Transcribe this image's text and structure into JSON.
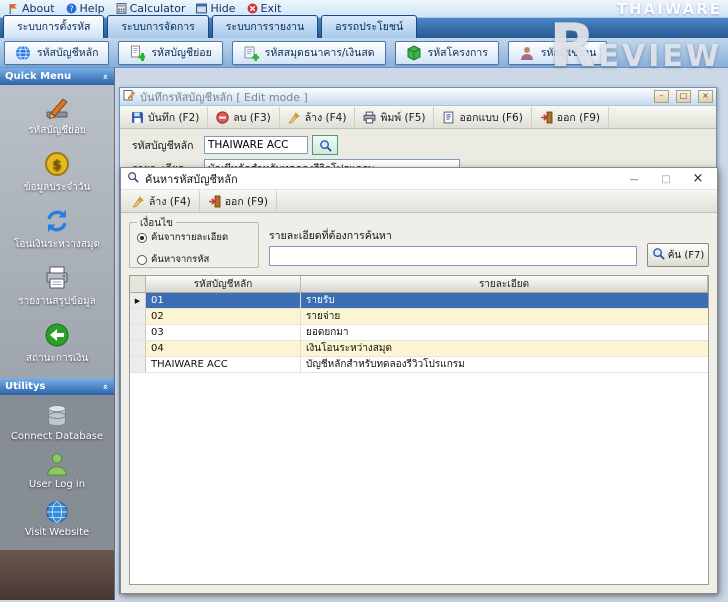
{
  "watermark": {
    "line1": "THAIWARE",
    "line2": "REVIEW"
  },
  "menubar": {
    "items": [
      {
        "label": "About"
      },
      {
        "label": "Help"
      },
      {
        "label": "Calculator"
      },
      {
        "label": "Hide"
      },
      {
        "label": "Exit"
      }
    ]
  },
  "tabs": [
    "ระบบการตั้งรหัส",
    "ระบบการจัดการ",
    "ระบบการรายงาน",
    "อรรถประโยชน์"
  ],
  "toolbar": {
    "buttons": [
      "รหัสบัญชีหลัก",
      "รหัสบัญชีย่อย",
      "รหัสสมุดธนาคาร/เงินสด",
      "รหัสโครงการ",
      "รหัสผู้ใช้งาน"
    ]
  },
  "sidebar": {
    "quick_menu": {
      "title": "Quick Menu",
      "items": [
        "รหัสบัญชีย่อย",
        "ข้อมูลประจำวัน",
        "โอนเงินระหว่างสมุด",
        "รายงานสรุปข้อมูล",
        "สถานะการเงิน"
      ]
    },
    "utilities": {
      "title": "Utilitys",
      "items": [
        "Connect Database",
        "User Log in",
        "Visit Website"
      ]
    }
  },
  "edit_window": {
    "title": "บันทึกรหัสบัญชีหลัก [ Edit mode ]",
    "toolbar": [
      "บันทึก (F2)",
      "ลบ (F3)",
      "ล้าง (F4)",
      "พิมพ์ (F5)",
      "ออกแบบ (F6)",
      "ออก (F9)"
    ],
    "fields": [
      {
        "label": "รหัสบัญชีหลัก",
        "value": "THAIWARE ACC"
      },
      {
        "label": "รายละเอียด",
        "value": "บัญชีหลักสำหรับทดลองรีวิวโปรแกรม"
      }
    ]
  },
  "search_dialog": {
    "title": "ค้นหารหัสบัญชีหลัก",
    "toolbar": [
      "ล้าง (F4)",
      "ออก (F9)"
    ],
    "condition": {
      "title": "เงื่อนไข",
      "options": [
        {
          "label": "ค้นจากรายละเอียด",
          "selected": true
        },
        {
          "label": "ค้นหาจากรหัส",
          "selected": false
        }
      ]
    },
    "search": {
      "label": "รายละเอียดที่ต้องการค้นหา",
      "value": "",
      "button": "ค้น (F7)"
    },
    "table": {
      "columns": [
        "รหัสบัญชีหลัก",
        "รายละเอียด"
      ],
      "rows": [
        {
          "code": "01",
          "description": "รายรับ",
          "selected": true
        },
        {
          "code": "02",
          "description": "รายจ่าย",
          "selected": false
        },
        {
          "code": "03",
          "description": "ยอดยกมา",
          "selected": false
        },
        {
          "code": "04",
          "description": "เงินโอนระหว่างสมุด",
          "selected": false
        },
        {
          "code": "THAIWARE ACC",
          "description": "บัญชีหลักสำหรับทดลองรีวิวโปรแกรม",
          "selected": false
        }
      ]
    }
  }
}
